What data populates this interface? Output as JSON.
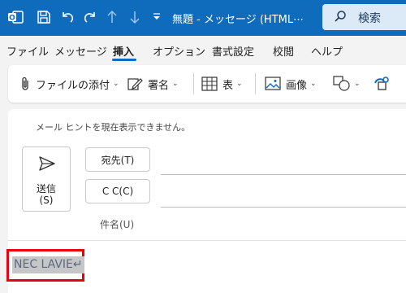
{
  "titlebar": {
    "title": "無題 - メッセージ (HTML⋯",
    "search_label": "検索",
    "icons": [
      "outlook-app-icon",
      "save-icon",
      "undo-icon",
      "redo-icon",
      "up-arrow-icon",
      "down-arrow-icon",
      "customize-toolbar-icon"
    ]
  },
  "menu": {
    "items": [
      "ファイル",
      "メッセージ",
      "挿入",
      "オプション",
      "書式設定",
      "校閲",
      "ヘルプ"
    ],
    "active": "挿入"
  },
  "ribbon": {
    "attach_label": "ファイルの添付",
    "signature_label": "署名",
    "table_label": "表",
    "image_label": "画像"
  },
  "compose": {
    "mailtip": "メール ヒントを現在表示できません。",
    "send_label_line1": "送信",
    "send_label_line2": "(S)",
    "to_label": "宛先(T)",
    "cc_label": "C C(C)",
    "subject_label": "件名(U)",
    "body_text": "NEC LAVIE↵"
  },
  "colors": {
    "accent": "#0f6cbd",
    "highlight_box": "#e60012",
    "selection": "#c6c6c6"
  }
}
